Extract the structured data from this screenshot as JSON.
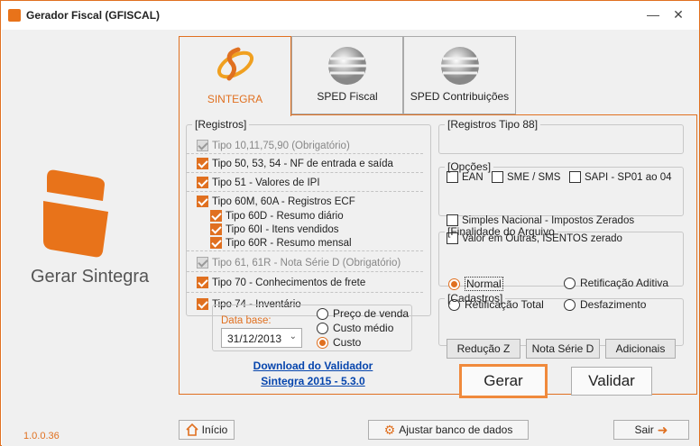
{
  "window": {
    "title": "Gerador Fiscal (GFISCAL)",
    "minimize_icon": "minimize-icon",
    "close_icon": "close-icon"
  },
  "brand": {
    "label": "Gerar Sintegra",
    "version": "1.0.0.36",
    "logo_icon": "sintegra-logo-icon"
  },
  "tabs": [
    {
      "label": "SINTEGRA",
      "icon": "sintegra-icon",
      "active": true
    },
    {
      "label": "SPED Fiscal",
      "icon": "globe-icon",
      "active": false
    },
    {
      "label": "SPED Contribuições",
      "icon": "globe-icon",
      "active": false
    }
  ],
  "registros": {
    "legend": "[Registros]",
    "items": [
      {
        "label": "Tipo 10,11,75,90 (Obrigatório)",
        "checked": true,
        "disabled": true
      },
      {
        "label": "Tipo 50, 53, 54 - NF de entrada e saída",
        "checked": true
      },
      {
        "label": "Tipo 51 - Valores de IPI",
        "checked": true
      },
      {
        "label": "Tipo 60M, 60A - Registros ECF",
        "checked": true
      },
      {
        "label": "Tipo 60D - Resumo diário",
        "checked": true
      },
      {
        "label": "Tipo 60I - Itens vendidos",
        "checked": true
      },
      {
        "label": "Tipo 60R - Resumo mensal",
        "checked": true
      },
      {
        "label": "Tipo 61, 61R - Nota Série D (Obrigatório)",
        "checked": true,
        "disabled": true
      },
      {
        "label": "Tipo 70 - Conhecimentos de frete",
        "checked": true
      },
      {
        "label": "Tipo 74 - Inventário",
        "checked": true
      }
    ]
  },
  "inventario": {
    "date_label": "Data base:",
    "date_value": "31/12/2013",
    "options": [
      "Preço de venda",
      "Custo médio",
      "Custo"
    ],
    "selected": "Custo"
  },
  "download": {
    "line1": "Download do Validador",
    "line2": "Sintegra 2015 - 5.3.0"
  },
  "tipo88": {
    "legend": "[Registros Tipo 88]",
    "items": [
      "EAN",
      "SME / SMS",
      "SAPI - SP01 ao 04"
    ]
  },
  "opcoes": {
    "legend": "[Opções]",
    "items": [
      "Simples Nacional - Impostos Zerados",
      "Valor em Outras, ISENTOS zerado"
    ]
  },
  "finalidade": {
    "legend": "[Finalidade do Arquivo",
    "options": [
      "Normal",
      "Retificação Aditiva",
      "Retificação Total",
      "Desfazimento"
    ],
    "selected": "Normal"
  },
  "cadastros": {
    "legend": "[Cadastros]",
    "buttons": [
      "Redução Z",
      "Nota Série D",
      "Adicionais"
    ]
  },
  "actions": {
    "gerar": "Gerar",
    "validar": "Validar"
  },
  "footer": {
    "inicio": "Início",
    "ajustar": "Ajustar banco de dados",
    "sair": "Sair"
  },
  "colors": {
    "accent": "#e07020",
    "link": "#0645ad"
  }
}
